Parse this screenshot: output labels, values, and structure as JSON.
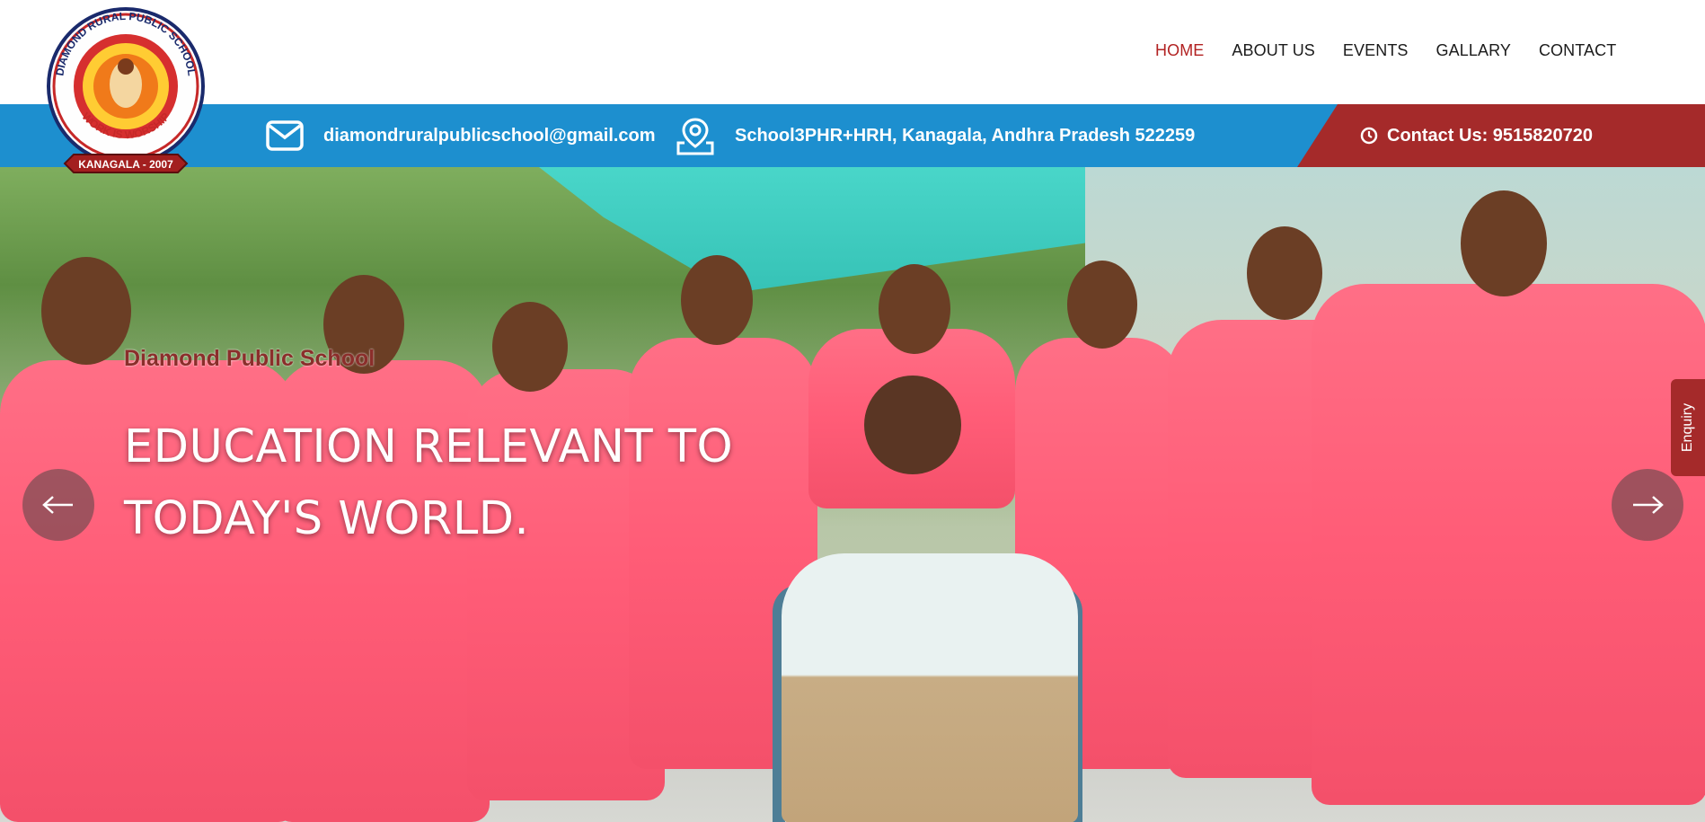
{
  "nav": {
    "items": [
      {
        "label": "HOME",
        "active": true
      },
      {
        "label": "ABOUT US",
        "active": false
      },
      {
        "label": "EVENTS",
        "active": false
      },
      {
        "label": "GALLARY",
        "active": false
      },
      {
        "label": "CONTACT",
        "active": false
      }
    ]
  },
  "logo": {
    "ring_text_top": "DIAMOND RURAL PUBLIC SCHOOL",
    "ring_text_bottom": "WORK IS WORSHIP",
    "ribbon_text": "KANAGALA - 2007"
  },
  "infobar": {
    "email": "diamondruralpublicschool@gmail.com",
    "address": "School3PHR+HRH, Kanagala, Andhra Pradesh 522259",
    "phone_label": "Contact Us: 9515820720"
  },
  "hero": {
    "subtitle": "Diamond Public School",
    "headline_line1": "EDUCATION RELEVANT TO",
    "headline_line2": "TODAY'S WORLD."
  },
  "side_tab": {
    "label": "Enquiry"
  },
  "colors": {
    "accent_red": "#a52a2a",
    "active_nav": "#b22222",
    "info_blue": "#1d8fcf"
  },
  "icons": {
    "email": "envelope-icon",
    "address": "map-pin-icon",
    "phone": "clock-icon",
    "prev": "arrow-left-icon",
    "next": "arrow-right-icon"
  }
}
